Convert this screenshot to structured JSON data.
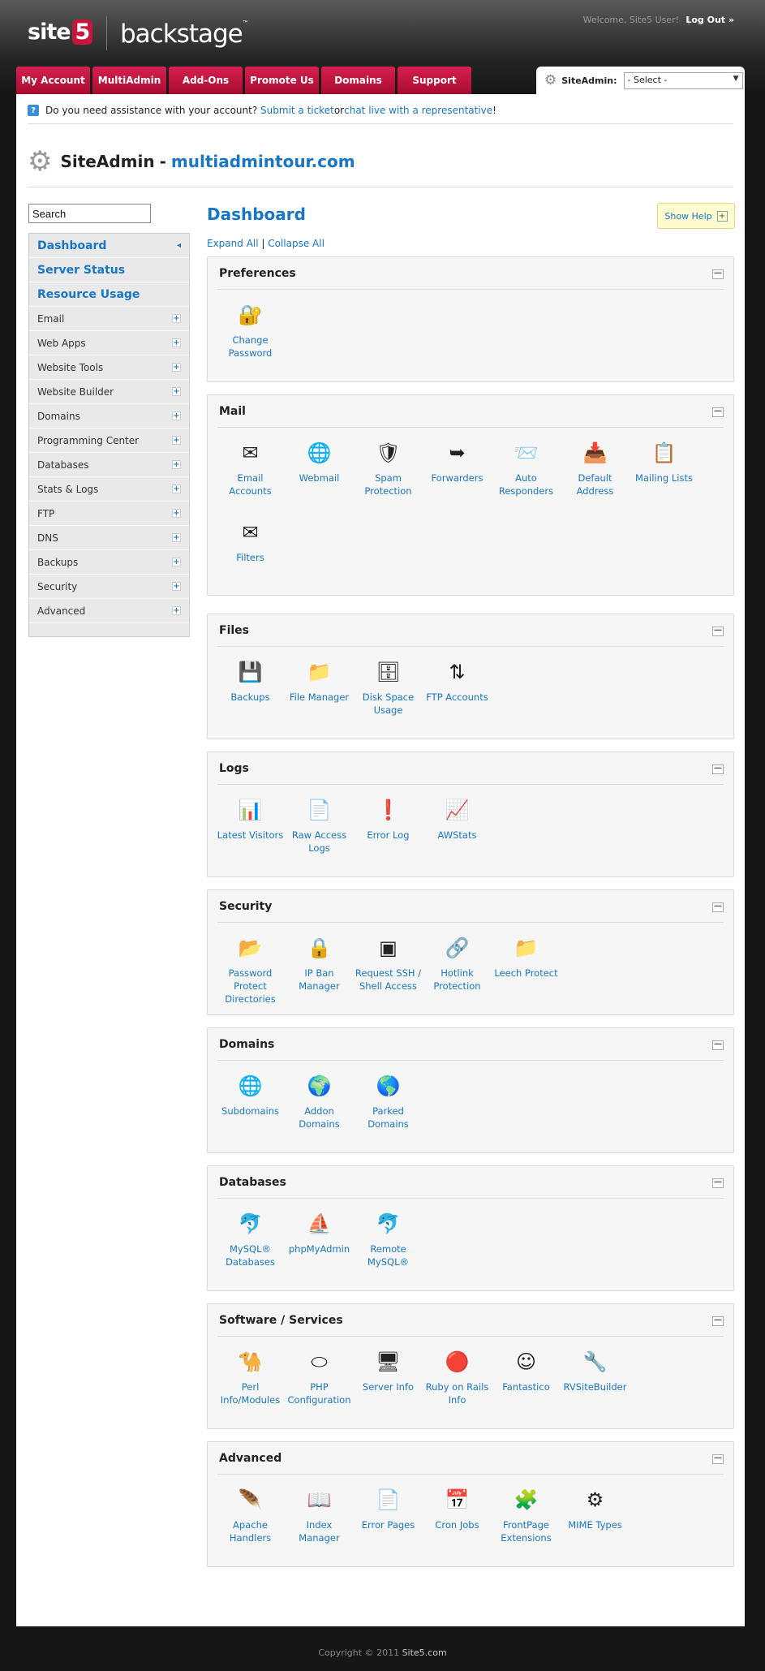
{
  "header": {
    "logo_site": "site",
    "logo_five": "5",
    "logo_back": "backstage",
    "welcome": "Welcome, Site5 User!",
    "separator": "|",
    "logout": "Log Out »"
  },
  "tabs": [
    "My Account",
    "MultiAdmin",
    "Add-Ons",
    "Promote Us",
    "Domains",
    "Support"
  ],
  "siteadmin": {
    "label": "SiteAdmin:",
    "select_value": "- Select -"
  },
  "assist": {
    "text1": "Do you need assistance with your account? ",
    "link1": "Submit a ticket",
    "text2": " or ",
    "link2": "chat live with a representative",
    "text3": "!"
  },
  "site_title": {
    "label": "SiteAdmin",
    "sep": "-",
    "domain": "multiadmintour.com"
  },
  "search": {
    "placeholder": "Search"
  },
  "sidebar": {
    "main": [
      "Dashboard",
      "Server Status",
      "Resource Usage"
    ],
    "items": [
      "Email",
      "Web Apps",
      "Website Tools",
      "Website Builder",
      "Domains",
      "Programming Center",
      "Databases",
      "Stats & Logs",
      "FTP",
      "DNS",
      "Backups",
      "Security",
      "Advanced"
    ]
  },
  "dashboard": {
    "title": "Dashboard",
    "show_help": "Show Help",
    "expand_all": "Expand All",
    "sep": " | ",
    "collapse_all": "Collapse All"
  },
  "panels": [
    {
      "title": "Preferences",
      "items": [
        {
          "label": "Change Password",
          "icon": "🔐"
        }
      ]
    },
    {
      "title": "Mail",
      "items": [
        {
          "label": "Email Accounts",
          "icon": "✉"
        },
        {
          "label": "Webmail",
          "icon": "🌐"
        },
        {
          "label": "Spam Protection",
          "icon": "🛡"
        },
        {
          "label": "Forwarders",
          "icon": "➥"
        },
        {
          "label": "Auto Responders",
          "icon": "📨"
        },
        {
          "label": "Default Address",
          "icon": "📥"
        },
        {
          "label": "Mailing Lists",
          "icon": "📋"
        },
        {
          "label": "Filters",
          "icon": "✉"
        }
      ]
    },
    {
      "title": "Files",
      "items": [
        {
          "label": "Backups",
          "icon": "💾"
        },
        {
          "label": "File Manager",
          "icon": "📁"
        },
        {
          "label": "Disk Space Usage",
          "icon": "🗄"
        },
        {
          "label": "FTP Accounts",
          "icon": "⇅"
        }
      ]
    },
    {
      "title": "Logs",
      "items": [
        {
          "label": "Latest Visitors",
          "icon": "📊"
        },
        {
          "label": "Raw Access Logs",
          "icon": "📄"
        },
        {
          "label": "Error Log",
          "icon": "❗"
        },
        {
          "label": "AWStats",
          "icon": "📈"
        }
      ]
    },
    {
      "title": "Security",
      "items": [
        {
          "label": "Password Protect Directories",
          "icon": "📂"
        },
        {
          "label": "IP Ban Manager",
          "icon": "🔒"
        },
        {
          "label": "Request SSH / Shell Access",
          "icon": "▣"
        },
        {
          "label": "Hotlink Protection",
          "icon": "🔗"
        },
        {
          "label": "Leech Protect",
          "icon": "📁"
        }
      ]
    },
    {
      "title": "Domains",
      "items": [
        {
          "label": "Subdomains",
          "icon": "🌐"
        },
        {
          "label": "Addon Domains",
          "icon": "🌍"
        },
        {
          "label": "Parked Domains",
          "icon": "🌎"
        }
      ]
    },
    {
      "title": "Databases",
      "items": [
        {
          "label": "MySQL® Databases",
          "icon": "🐬"
        },
        {
          "label": "phpMyAdmin",
          "icon": "⛵"
        },
        {
          "label": "Remote MySQL®",
          "icon": "🐬"
        }
      ]
    },
    {
      "title": "Software / Services",
      "items": [
        {
          "label": "Perl Info/Modules",
          "icon": "🐪"
        },
        {
          "label": "PHP Configuration",
          "icon": "⬭"
        },
        {
          "label": "Server Info",
          "icon": "🖥"
        },
        {
          "label": "Ruby on Rails Info",
          "icon": "🔴"
        },
        {
          "label": "Fantastico",
          "icon": "☺"
        },
        {
          "label": "RVSiteBuilder",
          "icon": "🔧"
        }
      ]
    },
    {
      "title": "Advanced",
      "items": [
        {
          "label": "Apache Handlers",
          "icon": "🪶"
        },
        {
          "label": "Index Manager",
          "icon": "📖"
        },
        {
          "label": "Error Pages",
          "icon": "📄"
        },
        {
          "label": "Cron Jobs",
          "icon": "📅"
        },
        {
          "label": "FrontPage Extensions",
          "icon": "🧩"
        },
        {
          "label": "MIME Types",
          "icon": "⚙"
        }
      ]
    }
  ],
  "footer": {
    "copyright": "Copyright © 2011 ",
    "site": "Site5.com"
  }
}
